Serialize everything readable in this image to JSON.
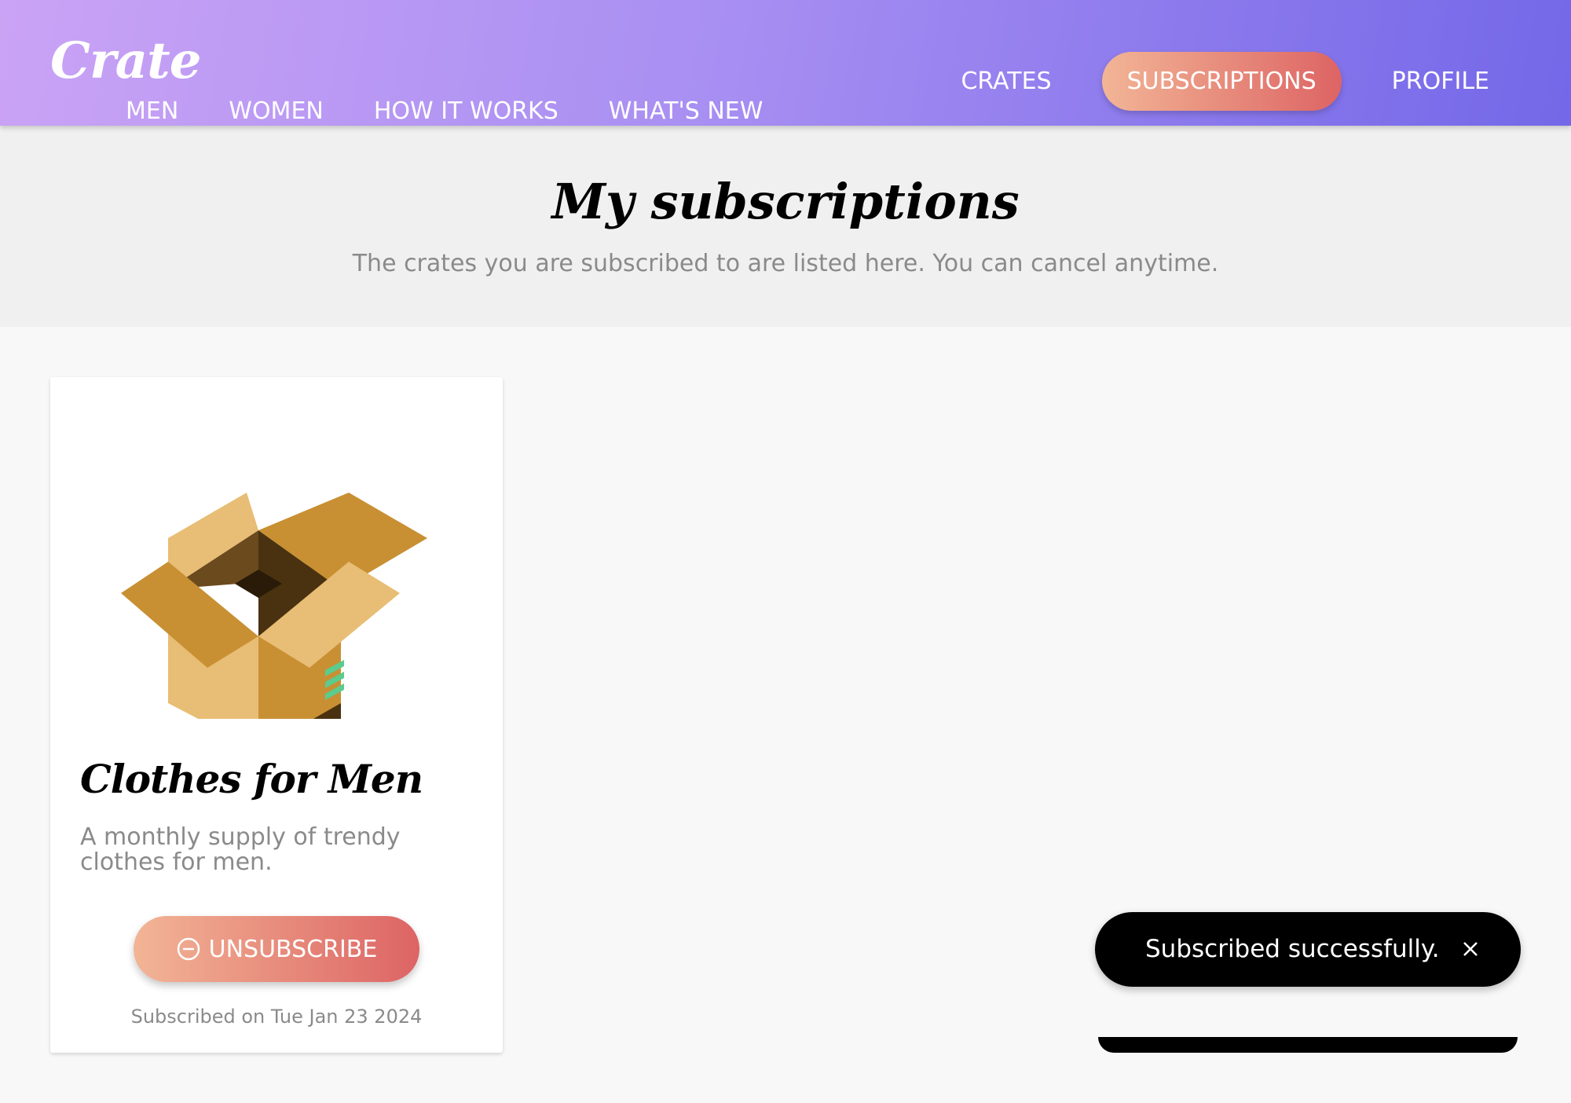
{
  "app": {
    "logo": "Crate"
  },
  "nav": {
    "left": [
      "Men",
      "Women",
      "How it works",
      "What's new"
    ],
    "right": [
      "Crates",
      "Subscriptions",
      "Profile"
    ],
    "active": "Subscriptions"
  },
  "hero": {
    "title": "My subscriptions",
    "subtitle": "The crates you are subscribed to are listed here. You can cancel anytime."
  },
  "subscriptions": [
    {
      "image_icon": "open-box-icon",
      "title": "Clothes for Men",
      "description": "A monthly supply of trendy clothes for men.",
      "button_label": "Unsubscribe",
      "button_icon": "minus-circle-icon",
      "date_text": "Subscribed on Tue Jan 23 2024"
    }
  ],
  "toast": {
    "message": "Subscribed successfully.",
    "close_icon": "close-icon"
  },
  "colors": {
    "header_gradient_start": "#caa3f5",
    "header_gradient_end": "#7468e8",
    "accent_gradient_start": "#f2b596",
    "accent_gradient_end": "#dd6464",
    "toast_bg": "#000000"
  }
}
